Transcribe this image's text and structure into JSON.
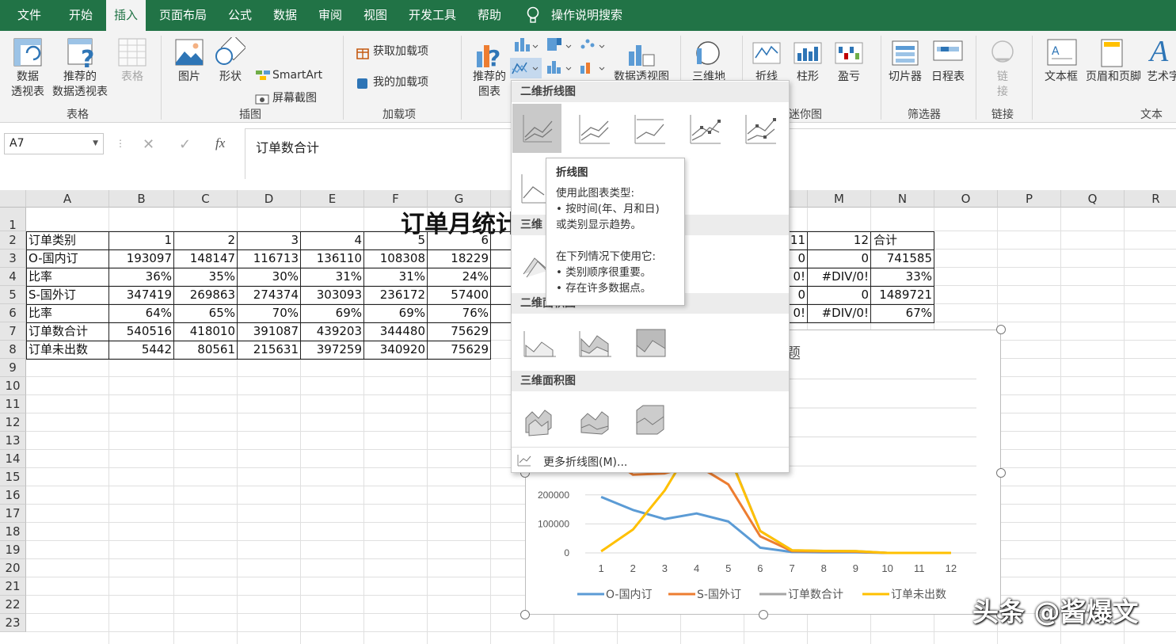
{
  "tabs": [
    "文件",
    "开始",
    "插入",
    "页面布局",
    "公式",
    "数据",
    "审阅",
    "视图",
    "开发工具",
    "帮助",
    "操作说明搜索"
  ],
  "ribbon": {
    "pivot": "数据\n透视表",
    "rec_pivot": "推荐的\n数据透视表",
    "table": "表格",
    "group_table": "表格",
    "picture": "图片",
    "shapes": "形状",
    "smartart": "SmartArt",
    "screenshot": "屏幕截图",
    "group_illus": "插图",
    "get_addins": "获取加载项",
    "my_addins": "我的加载项",
    "group_addins": "加载项",
    "rec_chart": "推荐的\n图表",
    "pivot_chart": "数据透视图",
    "map3d": "三维地",
    "spark_line": "折线",
    "spark_col": "柱形",
    "spark_wl": "盈亏",
    "group_spark": "迷你图",
    "slicer": "切片器",
    "timeline": "日程表",
    "group_filter": "筛选器",
    "link": "链\n接",
    "group_link": "链接",
    "textbox": "文本框",
    "header_footer": "页眉和页脚",
    "wordart": "艺术字",
    "group_text": "文本"
  },
  "formula_bar": {
    "name_box": "A7",
    "cancel": "✕",
    "enter": "✓",
    "fx": "fx",
    "content": "订单数合计"
  },
  "columns": [
    "A",
    "B",
    "C",
    "D",
    "E",
    "F",
    "G",
    "H",
    "I",
    "J",
    "K",
    "L",
    "M",
    "N",
    "O",
    "P",
    "Q",
    "R"
  ],
  "rows": [
    "1",
    "2",
    "3",
    "4",
    "5",
    "6",
    "7",
    "8",
    "9",
    "10",
    "11",
    "12",
    "13",
    "14",
    "15",
    "16",
    "17",
    "18",
    "19",
    "20",
    "21",
    "22",
    "23"
  ],
  "sheet": {
    "title": "订单月统计",
    "row2": [
      "订单类别",
      "1",
      "2",
      "3",
      "4",
      "5",
      "6",
      "11",
      "12",
      "合计"
    ],
    "row3": [
      "O-国内订",
      "193097",
      "148147",
      "116713",
      "136110",
      "108308",
      "18229",
      "0",
      "0",
      "741585"
    ],
    "row4": [
      "比率",
      "36%",
      "35%",
      "30%",
      "31%",
      "31%",
      "24%",
      "0!",
      "#DIV/0!",
      "33%"
    ],
    "row5": [
      "S-国外订",
      "347419",
      "269863",
      "274374",
      "303093",
      "236172",
      "57400",
      "0",
      "0",
      "1489721"
    ],
    "row6": [
      "比率",
      "64%",
      "65%",
      "70%",
      "69%",
      "69%",
      "76%",
      "0!",
      "#DIV/0!",
      "67%"
    ],
    "row7": [
      "订单数合计",
      "540516",
      "418010",
      "391087",
      "439203",
      "344480",
      "75629"
    ],
    "row8": [
      "订单未出数",
      "5442",
      "80561",
      "215631",
      "397259",
      "340920",
      "75629"
    ]
  },
  "chart_data": {
    "type": "line",
    "title": "题",
    "x": [
      1,
      2,
      3,
      4,
      5,
      6,
      7,
      8,
      9,
      10,
      11,
      12
    ],
    "y_ticks": [
      "200000",
      "100000",
      "0"
    ],
    "ylim": [
      0,
      600000
    ],
    "series": [
      {
        "name": "O-国内订",
        "color": "#5b9bd5",
        "values": [
          193097,
          148147,
          116713,
          136110,
          108308,
          18229,
          3000,
          2000,
          2000,
          0,
          0,
          0
        ]
      },
      {
        "name": "S-国外订",
        "color": "#ed7d31",
        "values": [
          347419,
          269863,
          274374,
          303093,
          236172,
          57400,
          6000,
          5000,
          4000,
          0,
          0,
          0
        ]
      },
      {
        "name": "订单数合计",
        "color": "#a5a5a5",
        "values": [
          540516,
          418010,
          391087,
          439203,
          344480,
          75629,
          9000,
          7000,
          6000,
          0,
          0,
          0
        ]
      },
      {
        "name": "订单未出数",
        "color": "#ffc000",
        "values": [
          5442,
          80561,
          215631,
          397259,
          340920,
          75629,
          9000,
          7000,
          6000,
          0,
          0,
          0
        ]
      }
    ],
    "legend": "bottom"
  },
  "dropdown": {
    "sec2d_line": "二维折线图",
    "sec3d_line": "三维",
    "sec2d_area": "二维面积图",
    "sec3d_area": "三维面积图",
    "more": "更多折线图(M)..."
  },
  "tooltip": {
    "title": "折线图",
    "l1": "使用此图表类型:",
    "l2": "• 按时间(年、月和日)",
    "l3": "或类别显示趋势。",
    "l4": "在下列情况下使用它:",
    "l5": "• 类别顺序很重要。",
    "l6": "• 存在许多数据点。"
  },
  "watermark": "头条 @酱爆文"
}
